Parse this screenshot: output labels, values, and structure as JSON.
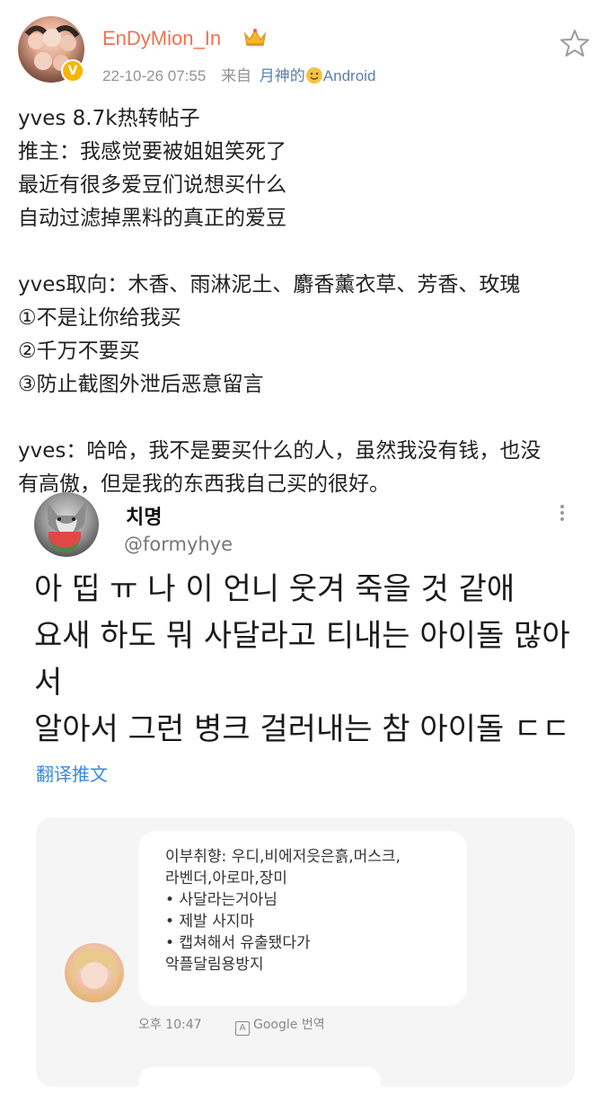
{
  "header": {
    "username": "EnDyMion_In",
    "timestamp": "22-10-26 07:55",
    "from_label": "来自",
    "source_prefix": "月神的",
    "source_suffix": "Android",
    "verified_badge": "V"
  },
  "post": {
    "lines": [
      "yves 8.7k热转帖子",
      "推主：我感觉要被姐姐笑死了",
      "最近有很多爱豆们说想买什么",
      "自动过滤掉黑料的真正的爱豆",
      "",
      "yves取向：木香、雨淋泥土、麝香薰衣草、芳香、玫瑰",
      "①不是让你给我买",
      "②千万不要买",
      "③防止截图外泄后恶意留言",
      "",
      "yves：哈哈，我不是要买什么的人，虽然我没有钱，也没",
      "有高傲，但是我的东西我自己买的很好。"
    ]
  },
  "tweet": {
    "name": "치명",
    "handle": "@formyhye",
    "body_lines": [
      "아 띱 ㅠ 나 이 언니 웃겨 죽을 것 같애",
      "요새 하도 뭐 사달라고 티내는 아이돌 많아",
      "서",
      "알아서 그런 병크 걸러내는 참 아이돌 ㄷㄷ"
    ],
    "translate_label": "翻译推文"
  },
  "message": {
    "lines": [
      "이부취향: 우디,비에저읏은흙,머스크,",
      "라벤더,아로마,장미",
      "• 사달라는거아님",
      "• 제발 사지마",
      "• 캡쳐해서 유출됐다가",
      "악플달림용방지"
    ],
    "time": "오후 10:47",
    "translate_label": "Google 번역",
    "translate_icon": "A"
  },
  "icons": {
    "favorite": "star-outline-icon",
    "more": "more-vertical-icon",
    "crown": "crown-icon",
    "smile": "smile-emoji-icon"
  },
  "colors": {
    "username": "#eb7350",
    "meta": "#939393",
    "source_link": "#5d7fa8",
    "translate_link": "#3b8ad9",
    "badge": "#f7b500"
  }
}
